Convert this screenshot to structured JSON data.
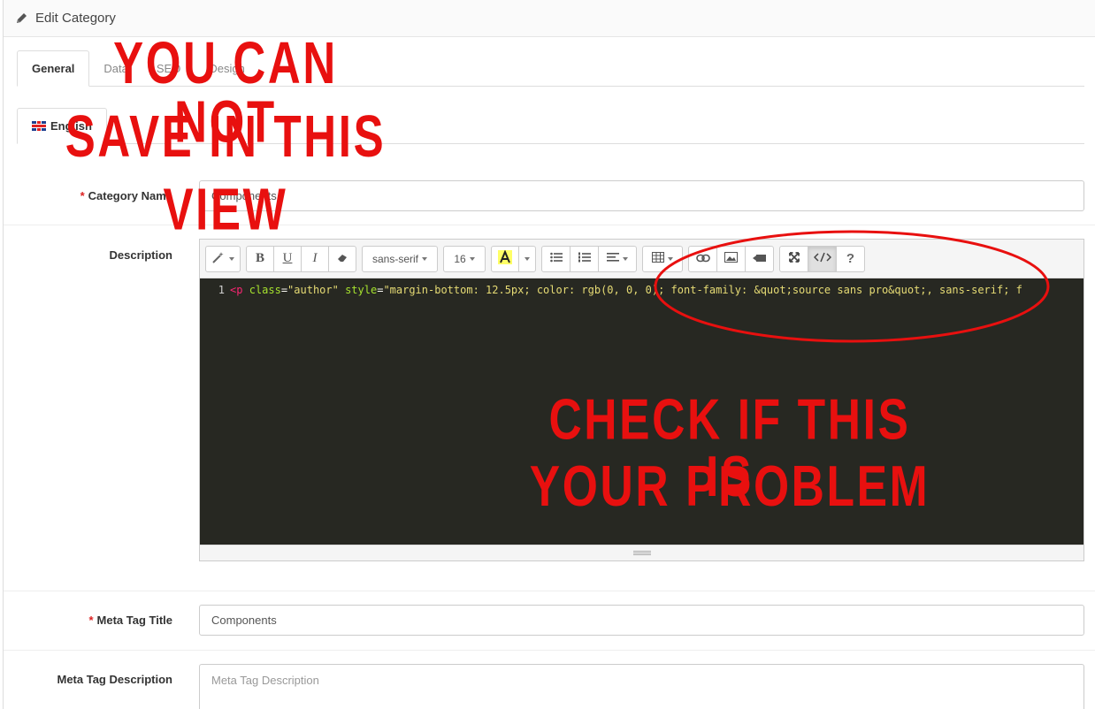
{
  "header": {
    "title": "Edit Category",
    "icon": "pencil-icon"
  },
  "tabs": [
    {
      "label": "General",
      "active": true
    },
    {
      "label": "Data",
      "active": false
    },
    {
      "label": "SEO",
      "active": false
    },
    {
      "label": "Design",
      "active": false
    }
  ],
  "language_tabs": [
    {
      "label": "English",
      "icon": "uk-flag-icon",
      "active": true
    }
  ],
  "fields": {
    "category_name": {
      "label": "Category Name",
      "required": true,
      "value": "Components"
    },
    "description": {
      "label": "Description"
    },
    "meta_title": {
      "label": "Meta Tag Title",
      "required": true,
      "value": "Components"
    },
    "meta_description": {
      "label": "Meta Tag Description",
      "placeholder": "Meta Tag Description"
    }
  },
  "editor": {
    "toolbar": {
      "font_name": "sans-serif",
      "font_size": "16",
      "help": "?"
    },
    "code": {
      "line_number": "1",
      "tag": "<p",
      "attr1": "class",
      "val1": "\"author\"",
      "attr2": "style",
      "val2": "\"margin-bottom: 12.5px; color: rgb(0, 0, 0); font-family: &quot;source sans pro&quot;, sans-serif; f"
    }
  },
  "annotations": {
    "top_left": [
      "YOU CAN NOT",
      "SAVE IN THIS",
      "VIEW"
    ],
    "center": [
      "CHECK IF THIS IS",
      "YOUR PROBLEM"
    ],
    "color": "#e8100f"
  },
  "required_mark": "*"
}
